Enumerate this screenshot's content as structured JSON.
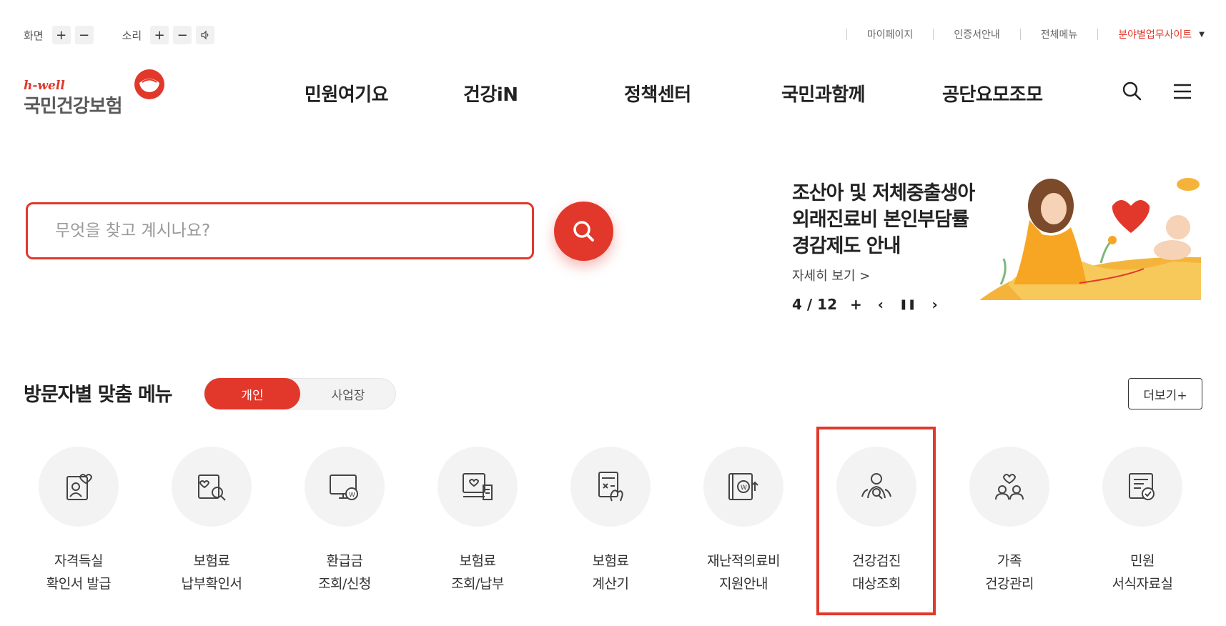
{
  "utility": {
    "screen_label": "화면",
    "sound_label": "소리",
    "plus": "+",
    "minus": "−",
    "links": [
      "마이페이지",
      "인증서안내",
      "전체메뉴"
    ],
    "family_site": "분야별업무사이트",
    "family_caret": "▼"
  },
  "logo": {
    "hwell": "h-well",
    "name": "국민건강보험"
  },
  "gnb": [
    "민원여기요",
    "건강iN",
    "정책센터",
    "국민과함께",
    "공단요모조모"
  ],
  "search": {
    "placeholder": "무엇을 찾고 계시나요?"
  },
  "banner": {
    "lines": [
      "조산아 및 저체중출생아",
      "외래진료비 본인부담률",
      "경감제도 안내"
    ],
    "more": "자세히 보기 >",
    "count": "4 / 12",
    "plus": "+",
    "prev": "‹",
    "pause": "❚❚",
    "next": "›"
  },
  "visitor_menu": {
    "title": "방문자별 맞춤 메뉴",
    "tab_personal": "개인",
    "tab_business": "사업장",
    "more": "더보기+",
    "items": [
      {
        "line1": "자격득실",
        "line2": "확인서 발급",
        "icon": "id-card-heart-icon"
      },
      {
        "line1": "보험료",
        "line2": "납부확인서",
        "icon": "document-search-icon"
      },
      {
        "line1": "환급금",
        "line2": "조회/신청",
        "icon": "monitor-won-icon"
      },
      {
        "line1": "보험료",
        "line2": "조회/납부",
        "icon": "bill-heart-icon"
      },
      {
        "line1": "보험료",
        "line2": "계산기",
        "icon": "calculator-hand-icon"
      },
      {
        "line1": "재난적의료비",
        "line2": "지원안내",
        "icon": "book-won-icon"
      },
      {
        "line1": "건강검진",
        "line2": "대상조회",
        "icon": "person-search-icon"
      },
      {
        "line1": "가족",
        "line2": "건강관리",
        "icon": "family-heart-icon"
      },
      {
        "line1": "민원",
        "line2": "서식자료실",
        "icon": "document-check-icon"
      }
    ]
  },
  "colors": {
    "accent": "#e2382b",
    "icon_bg": "#f3f3f3"
  }
}
